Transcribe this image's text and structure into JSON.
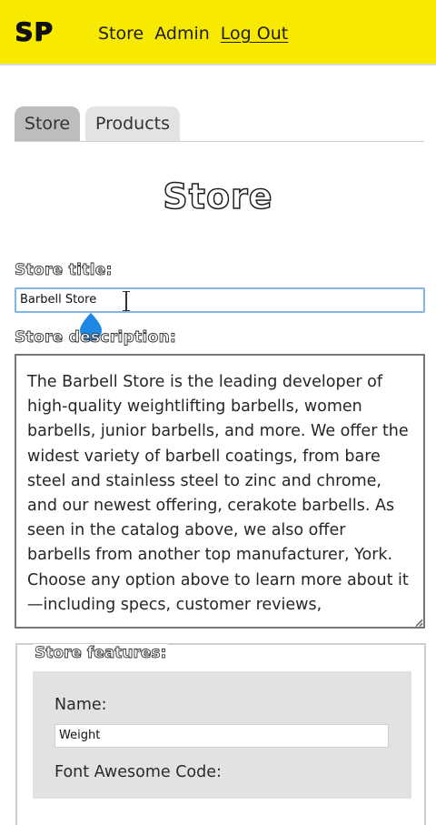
{
  "header": {
    "logo": "SP",
    "nav": [
      "Store",
      "Admin",
      "Log Out"
    ]
  },
  "tabs": [
    {
      "label": "Store",
      "active": true
    },
    {
      "label": "Products",
      "active": false
    }
  ],
  "page_title": "Store",
  "store_title": {
    "label": "Store title:",
    "value": "Barbell Store"
  },
  "store_description": {
    "label": "Store description:",
    "value": "The Barbell Store is the leading developer of high-quality weightlifting barbells, women barbells, junior barbells, and more. We offer the widest variety of barbell coatings, from bare steel and stainless steel to zinc and chrome, and our newest offering, cerakote barbells. As seen in the catalog above, we also offer barbells from another top manufacturer, York. Choose any option above to learn more about it—including specs, customer reviews,"
  },
  "features": {
    "legend": "Store features:",
    "name_label": "Name:",
    "name_value": "Weight",
    "fa_label": "Font Awesome Code:"
  },
  "colors": {
    "header_bg": "#f8e900",
    "tab_active": "#bdbdbd",
    "tab_inactive": "#e3e3e3",
    "focus_border": "#7fb6e5",
    "feature_card_bg": "#e2e2e2",
    "touch_handle": "#1e88e5"
  },
  "icons": {
    "text_cursor": "ibeam-cursor-icon",
    "selection_handle": "touch-selection-handle-icon",
    "resize_grip": "resize-grip-icon"
  }
}
